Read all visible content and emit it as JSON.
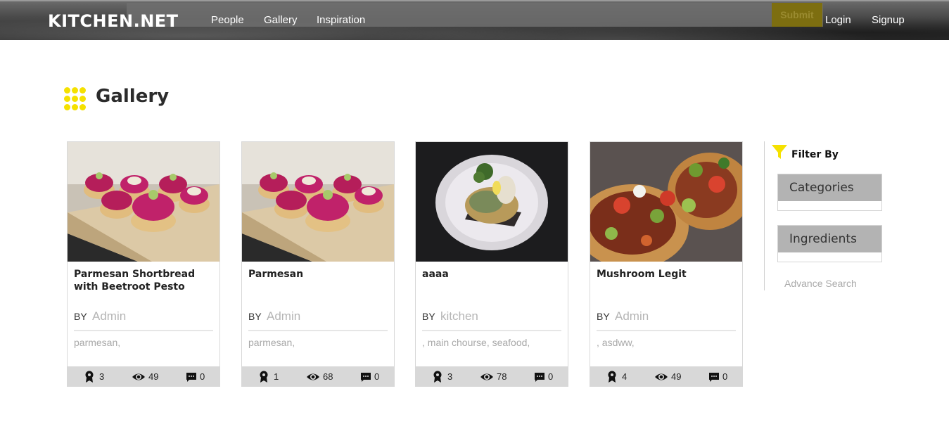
{
  "header": {
    "logo": "KITCHEN.NET",
    "nav": [
      "People",
      "Gallery",
      "Inspiration"
    ],
    "submit_label": "Submit",
    "login": "Login",
    "signup": "Signup"
  },
  "page": {
    "title": "Gallery",
    "title_icon": "grid-dots-icon"
  },
  "cards": [
    {
      "title": "Parmesan Shortbread with Beetroot Pesto",
      "by": "BY",
      "author": "Admin",
      "tags": "parmesan,",
      "image": "beetroot-shortbread-photo",
      "awards": "3",
      "views": "49",
      "comments": "0"
    },
    {
      "title": "Parmesan",
      "by": "BY",
      "author": "Admin",
      "tags": "parmesan,",
      "image": "beetroot-shortbread-photo",
      "awards": "1",
      "views": "68",
      "comments": "0"
    },
    {
      "title": "aaaa",
      "by": "BY",
      "author": "kitchen",
      "tags": ", main chourse, seafood,",
      "image": "plated-dish-photo",
      "awards": "3",
      "views": "78",
      "comments": "0"
    },
    {
      "title": "Mushroom Legit",
      "by": "BY",
      "author": "Admin",
      "tags": ", asdww,",
      "image": "tostada-photo",
      "awards": "4",
      "views": "49",
      "comments": "0"
    }
  ],
  "filter": {
    "label": "Filter By",
    "categories": "Categories",
    "ingredients": "Ingredients",
    "advance_search": "Advance Search"
  },
  "colors": {
    "accent_yellow": "#f5e100",
    "footer_gray": "#d8d8d8",
    "filter_header_gray": "#b3b3b3"
  }
}
